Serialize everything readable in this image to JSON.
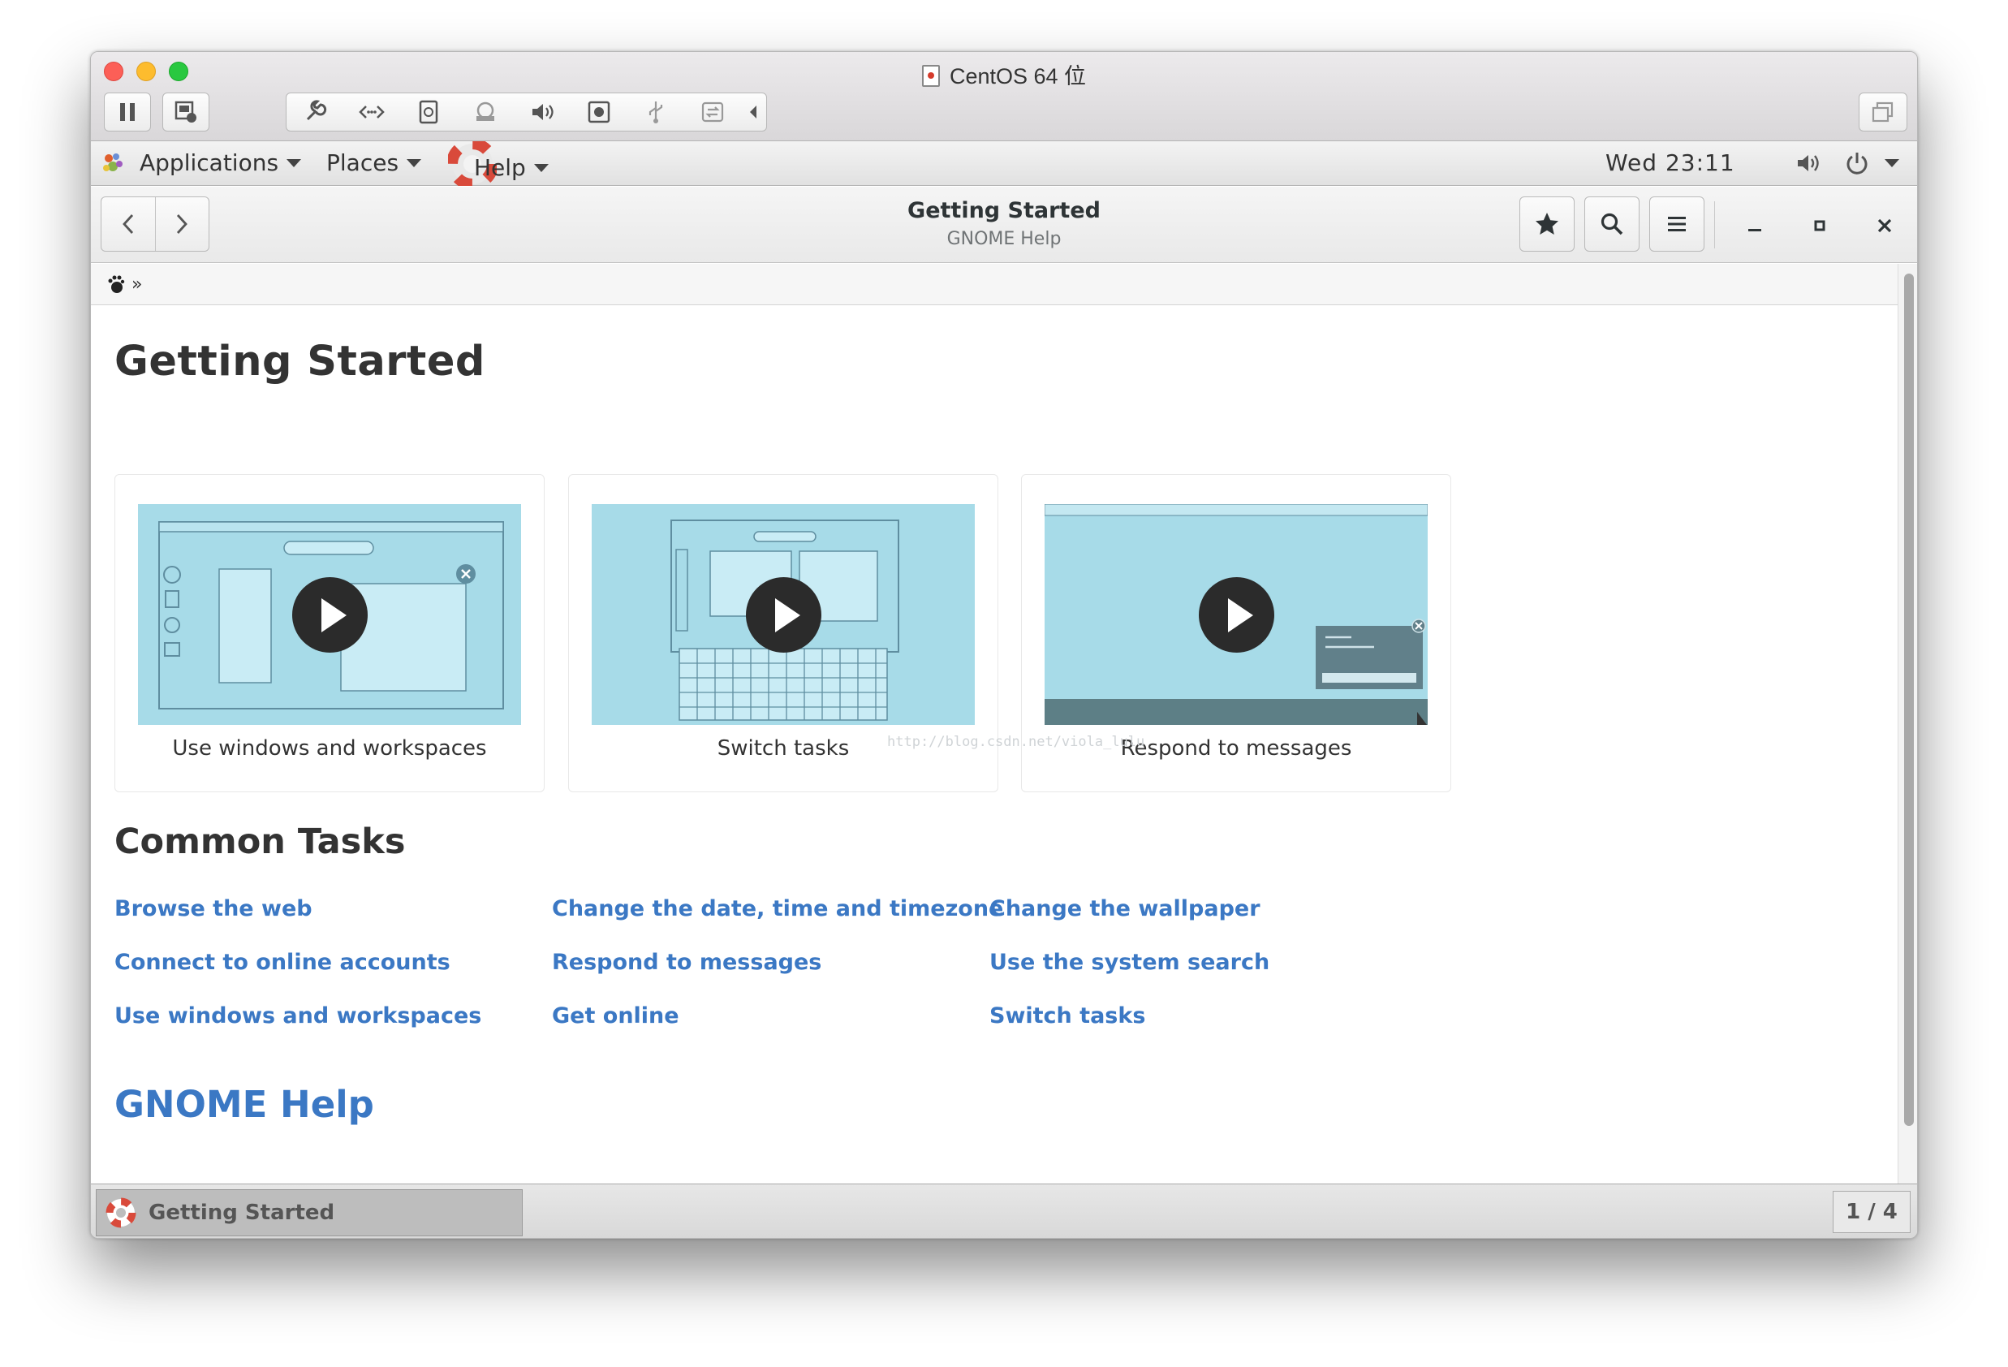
{
  "vm": {
    "title": "CentOS 64 位"
  },
  "gnome_panel": {
    "applications": "Applications",
    "places": "Places",
    "help": "Help",
    "clock": "Wed 23:11"
  },
  "header": {
    "title": "Getting Started",
    "subtitle": "GNOME Help"
  },
  "breadcrumb": {
    "separator": "»"
  },
  "page": {
    "heading": "Getting Started",
    "videos": [
      {
        "caption": "Use windows and workspaces"
      },
      {
        "caption": "Switch tasks"
      },
      {
        "caption": "Respond to messages"
      }
    ],
    "watermark": "http://blog.csdn.net/viola_lulu",
    "common_tasks_heading": "Common Tasks",
    "tasks": [
      [
        "Browse the web",
        "Connect to online accounts",
        "Use windows and workspaces"
      ],
      [
        "Change the date, time and timezone",
        "Respond to messages",
        "Get online"
      ],
      [
        "Change the wallpaper",
        "Use the system search",
        "Switch tasks"
      ]
    ],
    "footer_link": "GNOME Help"
  },
  "taskbar": {
    "window_label": "Getting Started",
    "workspace": "1 / 4"
  },
  "colors": {
    "link": "#3b78c4",
    "thumb_bg": "#a7dbe8"
  }
}
